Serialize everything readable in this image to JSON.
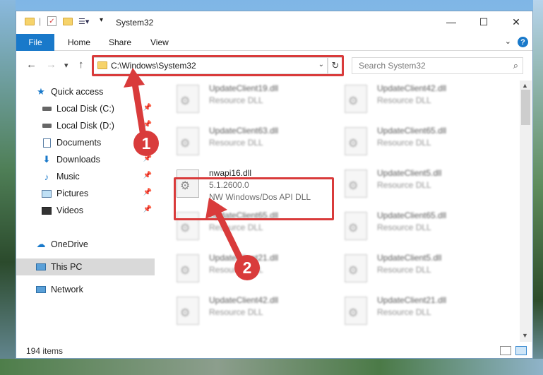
{
  "window": {
    "title": "System32",
    "minimize": "—",
    "maximize": "☐",
    "close": "✕"
  },
  "ribbon": {
    "tabs": [
      "File",
      "Home",
      "Share",
      "View"
    ],
    "help": "?"
  },
  "nav": {
    "back": "←",
    "forward": "→",
    "recent": "▾",
    "up": "↑",
    "address": "C:\\Windows\\System32",
    "refresh": "↻",
    "search_placeholder": "Search System32"
  },
  "sidebar": {
    "items": [
      {
        "label": "Quick access",
        "icon": "star-icon"
      },
      {
        "label": "Local Disk (C:)",
        "icon": "drive-icon"
      },
      {
        "label": "Local Disk (D:)",
        "icon": "drive-icon"
      },
      {
        "label": "Documents",
        "icon": "documents-icon"
      },
      {
        "label": "Downloads",
        "icon": "downloads-icon"
      },
      {
        "label": "Music",
        "icon": "music-icon"
      },
      {
        "label": "Pictures",
        "icon": "pictures-icon"
      },
      {
        "label": "Videos",
        "icon": "videos-icon"
      },
      {
        "label": "OneDrive",
        "icon": "cloud-icon"
      },
      {
        "label": "This PC",
        "icon": "computer-icon"
      },
      {
        "label": "Network",
        "icon": "network-icon"
      }
    ]
  },
  "files": {
    "left": [
      {
        "name": "UpdateClient19.dll",
        "type": "Resource DLL"
      },
      {
        "name": "UpdateClient63.dll",
        "type": "Resource DLL"
      },
      {
        "name": "nwapi16.dll",
        "version": "5.1.2600.0",
        "type": "NW Windows/Dos API DLL"
      },
      {
        "name": "UpdateClient65.dll",
        "type": "Resource DLL"
      },
      {
        "name": "UpdateClient21.dll",
        "type": "Resource DLL"
      },
      {
        "name": "UpdateClient42.dll",
        "type": "Resource DLL"
      }
    ],
    "right": [
      {
        "name": "UpdateClient42.dll",
        "type": "Resource DLL"
      },
      {
        "name": "UpdateClient65.dll",
        "type": "Resource DLL"
      },
      {
        "name": "UpdateClient5.dll",
        "type": "Resource DLL"
      },
      {
        "name": "UpdateClient65.dll",
        "type": "Resource DLL"
      },
      {
        "name": "UpdateClient5.dll",
        "type": "Resource DLL"
      },
      {
        "name": "UpdateClient21.dll",
        "type": "Resource DLL"
      }
    ]
  },
  "status": {
    "item_count": "194 items"
  },
  "annotations": {
    "step1": "1",
    "step2": "2",
    "highlight_color": "#d93b3b"
  }
}
